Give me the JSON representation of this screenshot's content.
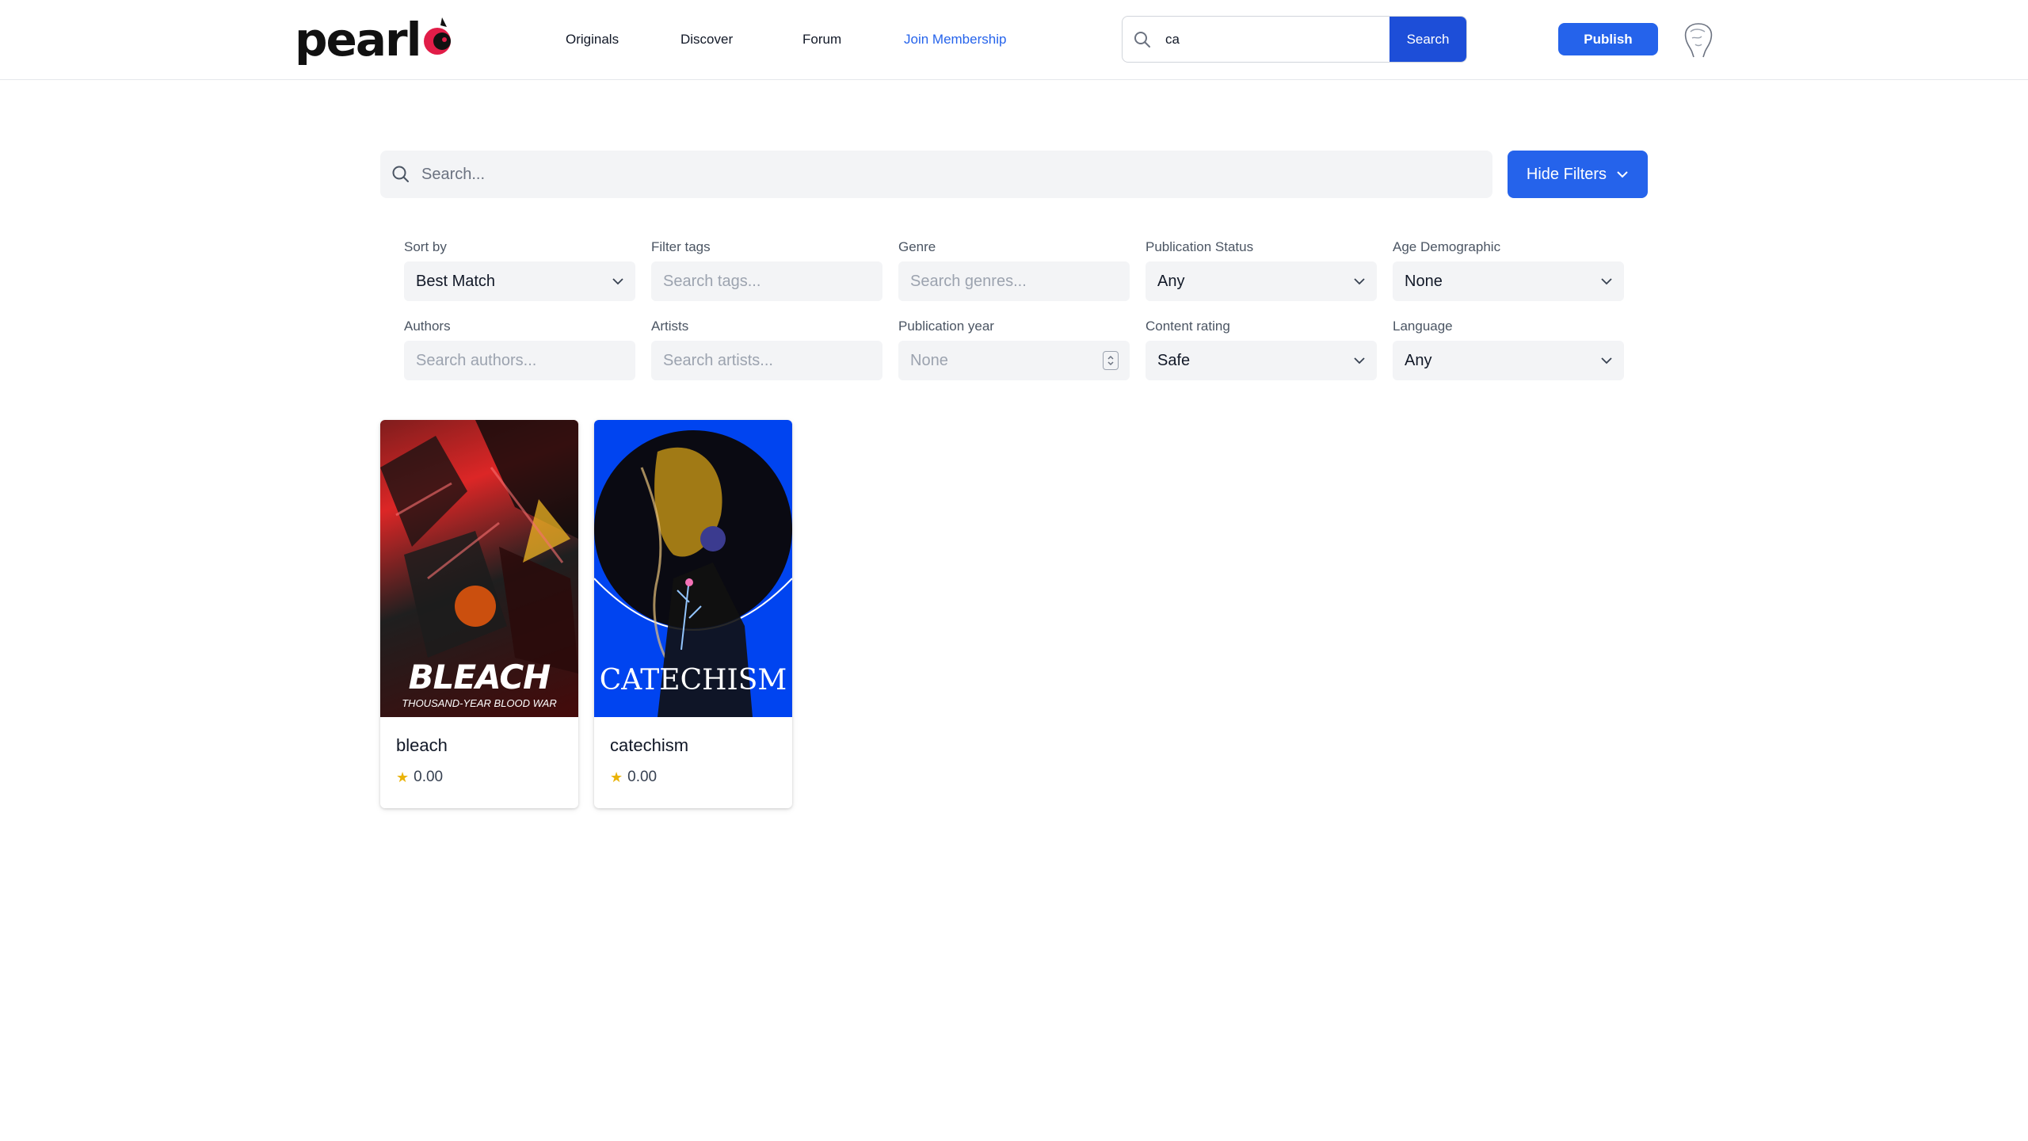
{
  "header": {
    "logo_text": "pearl",
    "nav": {
      "originals": "Originals",
      "discover": "Discover",
      "forum": "Forum",
      "membership": "Join Membership"
    },
    "search": {
      "value": "ca",
      "button": "Search"
    },
    "publish": "Publish",
    "accent_color": "#2563eb"
  },
  "search": {
    "placeholder": "Search...",
    "hide_filters": "Hide Filters"
  },
  "filters": {
    "sort_by": {
      "label": "Sort by",
      "value": "Best Match"
    },
    "filter_tags": {
      "label": "Filter tags",
      "placeholder": "Search tags..."
    },
    "genre": {
      "label": "Genre",
      "placeholder": "Search genres..."
    },
    "publication_status": {
      "label": "Publication Status",
      "value": "Any"
    },
    "age_demographic": {
      "label": "Age Demographic",
      "value": "None"
    },
    "authors": {
      "label": "Authors",
      "placeholder": "Search authors..."
    },
    "artists": {
      "label": "Artists",
      "placeholder": "Search artists..."
    },
    "publication_year": {
      "label": "Publication year",
      "placeholder": "None"
    },
    "content_rating": {
      "label": "Content rating",
      "value": "Safe"
    },
    "language": {
      "label": "Language",
      "value": "Any"
    }
  },
  "results": [
    {
      "title": "bleach",
      "rating": "0.00",
      "cover_title": "BLEACH",
      "cover_subtitle": "THOUSAND-YEAR BLOOD WAR"
    },
    {
      "title": "catechism",
      "rating": "0.00",
      "cover_title": "CATECHISM"
    }
  ]
}
